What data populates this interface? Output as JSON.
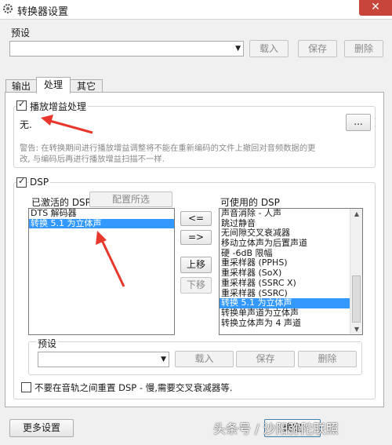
{
  "window": {
    "title": "转换器设置"
  },
  "preset_top": {
    "label": "预设",
    "value": "",
    "buttons": {
      "load": "载入",
      "save": "保存",
      "delete": "删除"
    }
  },
  "tabs": [
    {
      "label": "输出"
    },
    {
      "label": "处理"
    },
    {
      "label": "其它"
    }
  ],
  "replaygain": {
    "checkbox_label": "播放增益处理",
    "checked": true,
    "value": "无.",
    "browse_button": "...",
    "warning_line1": "警告: 在转换期间进行播放增益调整将不能在重新编码的文件上撤回对音频数据的更",
    "warning_line2": "改, 与编码后再进行播放增益扫描不一样."
  },
  "dsp": {
    "checkbox_label": "DSP",
    "checked": true,
    "active_label": "已激活的 DSP",
    "configure_button": "配置所选",
    "available_label": "可使用的 DSP",
    "active_items": [
      "DTS 解码器",
      "转换 5.1 为立体声"
    ],
    "active_selected_index": 1,
    "available_items": [
      "声音消除 - 人声",
      "跳过静音",
      "无间隙交叉衰减器",
      "移动立体声为后置声道",
      "硬 -6dB 限幅",
      "重采样器 (PPHS)",
      "重采样器 (SoX)",
      "重采样器 (SSRC X)",
      "重采样器 (SSRC)",
      "转换 5.1 为立体声",
      "转换单声道为立体声",
      "转换立体声为 4 声道"
    ],
    "available_selected_index": 9,
    "move_buttons": {
      "add": "<=",
      "remove": "=>",
      "up": "上移",
      "down": "下移"
    },
    "preset": {
      "label": "预设",
      "value": "",
      "buttons": {
        "load": "载入",
        "save": "保存",
        "delete": "删除"
      }
    },
    "no_reset_checkbox_label": "不要在音轨之间重置 DSP - 慢,需要交叉衰减器等.",
    "no_reset_checked": false
  },
  "bottom": {
    "more_settings": "更多设置",
    "ok": "确定"
  },
  "watermark": "头条号 / 沙阳弥陀联照",
  "colors": {
    "selection": "#3399ff",
    "close_button": "#c7453b",
    "annotation_arrow": "#e8382e"
  },
  "icons": {
    "title": "gear-icon",
    "combo": "chevron-down-icon"
  }
}
